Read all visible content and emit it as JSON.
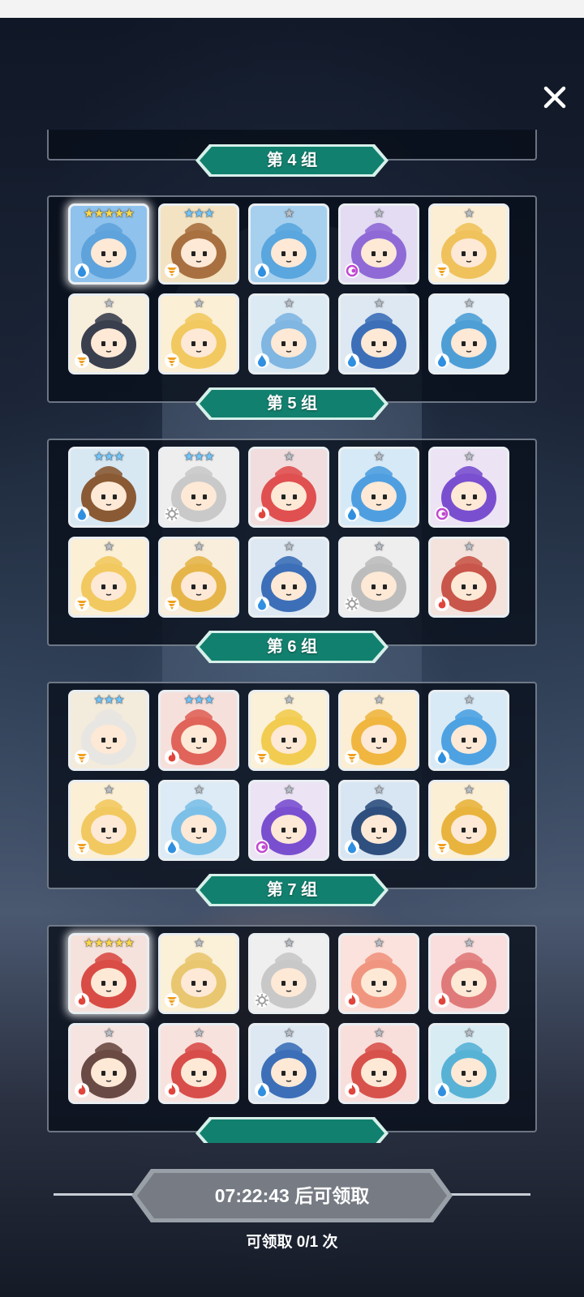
{
  "close_icon": "close-icon",
  "groups": [
    {
      "label": "第 4 组",
      "heroes": [
        {
          "stars": "★★★★★",
          "star_color": "#ffd84a",
          "element": "water",
          "bg": "#8fc2ec",
          "body": "#5fa3dc",
          "highlight": true
        },
        {
          "stars": "★★★",
          "star_color": "#6fc6ff",
          "element": "wind",
          "bg": "#f3e3c2",
          "body": "#a87040",
          "highlight": false
        },
        {
          "stars": "★",
          "star_color": "#b8bec6",
          "element": "water",
          "bg": "#a7d0ef",
          "body": "#5aa6de",
          "highlight": false
        },
        {
          "stars": "★",
          "star_color": "#b8bec6",
          "element": "dark",
          "bg": "#e3dcf2",
          "body": "#8f6ad6",
          "highlight": false
        },
        {
          "stars": "★",
          "star_color": "#b8bec6",
          "element": "wind",
          "bg": "#fbeed4",
          "body": "#f0c25c",
          "highlight": false
        },
        {
          "stars": "★",
          "star_color": "#b8bec6",
          "element": "wind",
          "bg": "#f7eedc",
          "body": "#3a3f4e",
          "highlight": false
        },
        {
          "stars": "★",
          "star_color": "#b8bec6",
          "element": "wind",
          "bg": "#fbefd6",
          "body": "#f2c960",
          "highlight": false
        },
        {
          "stars": "★",
          "star_color": "#b8bec6",
          "element": "water",
          "bg": "#dceaf4",
          "body": "#7fb6e2",
          "highlight": false
        },
        {
          "stars": "★",
          "star_color": "#b8bec6",
          "element": "water",
          "bg": "#dde8f2",
          "body": "#3c6fb8",
          "highlight": false
        },
        {
          "stars": "★",
          "star_color": "#b8bec6",
          "element": "water",
          "bg": "#e3eef6",
          "body": "#4e9ed6",
          "highlight": false
        }
      ]
    },
    {
      "label": "第 5 组",
      "heroes": [
        {
          "stars": "★★★",
          "star_color": "#6fc6ff",
          "element": "water",
          "bg": "#d7e8f3",
          "body": "#8a5a34",
          "highlight": false
        },
        {
          "stars": "★★★",
          "star_color": "#6fc6ff",
          "element": "light",
          "bg": "#eeeeee",
          "body": "#c9c9c9",
          "highlight": false
        },
        {
          "stars": "★",
          "star_color": "#b8bec6",
          "element": "fire",
          "bg": "#f1dddd",
          "body": "#e05050",
          "highlight": false
        },
        {
          "stars": "★",
          "star_color": "#b8bec6",
          "element": "water",
          "bg": "#d6e9f6",
          "body": "#4f9fe0",
          "highlight": false
        },
        {
          "stars": "★",
          "star_color": "#b8bec6",
          "element": "dark",
          "bg": "#ece3f5",
          "body": "#7a4fcf",
          "highlight": false
        },
        {
          "stars": "★",
          "star_color": "#b8bec6",
          "element": "wind",
          "bg": "#fbefd6",
          "body": "#f2c960",
          "highlight": false
        },
        {
          "stars": "★",
          "star_color": "#b8bec6",
          "element": "wind",
          "bg": "#f8eedb",
          "body": "#e6b54a",
          "highlight": false
        },
        {
          "stars": "★",
          "star_color": "#b8bec6",
          "element": "water",
          "bg": "#dde8f2",
          "body": "#3c6fb8",
          "highlight": false
        },
        {
          "stars": "★",
          "star_color": "#b8bec6",
          "element": "light",
          "bg": "#eeeeee",
          "body": "#bcbcbc",
          "highlight": false
        },
        {
          "stars": "★",
          "star_color": "#b8bec6",
          "element": "fire",
          "bg": "#f3e3dc",
          "body": "#c9564a",
          "highlight": false
        }
      ]
    },
    {
      "label": "第 6 组",
      "heroes": [
        {
          "stars": "★★★",
          "star_color": "#6fc6ff",
          "element": "wind",
          "bg": "#f3ebdc",
          "body": "#e8e6e2",
          "highlight": false
        },
        {
          "stars": "★★★",
          "star_color": "#6fc6ff",
          "element": "fire",
          "bg": "#f6e0dc",
          "body": "#e0645a",
          "highlight": false
        },
        {
          "stars": "★",
          "star_color": "#b8bec6",
          "element": "wind",
          "bg": "#fbf1d8",
          "body": "#f2cc50",
          "highlight": false
        },
        {
          "stars": "★",
          "star_color": "#b8bec6",
          "element": "wind",
          "bg": "#fbeed4",
          "body": "#f0b640",
          "highlight": false
        },
        {
          "stars": "★",
          "star_color": "#b8bec6",
          "element": "water",
          "bg": "#d8eaf6",
          "body": "#4ea2e2",
          "highlight": false
        },
        {
          "stars": "★",
          "star_color": "#b8bec6",
          "element": "wind",
          "bg": "#fbefd6",
          "body": "#f2c960",
          "highlight": false
        },
        {
          "stars": "★",
          "star_color": "#b8bec6",
          "element": "water",
          "bg": "#dcebf6",
          "body": "#7cc0e8",
          "highlight": false
        },
        {
          "stars": "★",
          "star_color": "#b8bec6",
          "element": "dark",
          "bg": "#ece3f5",
          "body": "#7a4fcf",
          "highlight": false
        },
        {
          "stars": "★",
          "star_color": "#b8bec6",
          "element": "water",
          "bg": "#d8e6f3",
          "body": "#2f4f7e",
          "highlight": false
        },
        {
          "stars": "★",
          "star_color": "#b8bec6",
          "element": "wind",
          "bg": "#fbefd6",
          "body": "#e9b43e",
          "highlight": false
        }
      ]
    },
    {
      "label": "第 7 组",
      "heroes": [
        {
          "stars": "★★★★★",
          "star_color": "#ffd84a",
          "element": "fire",
          "bg": "#f5e2dc",
          "body": "#d94c46",
          "highlight": true
        },
        {
          "stars": "★",
          "star_color": "#b8bec6",
          "element": "wind",
          "bg": "#fbf0d8",
          "body": "#e9c670",
          "highlight": false
        },
        {
          "stars": "★",
          "star_color": "#b8bec6",
          "element": "light",
          "bg": "#efefef",
          "body": "#c8c8c8",
          "highlight": false
        },
        {
          "stars": "★",
          "star_color": "#b8bec6",
          "element": "fire",
          "bg": "#fbe2dc",
          "body": "#f09680",
          "highlight": false
        },
        {
          "stars": "★",
          "star_color": "#b8bec6",
          "element": "fire",
          "bg": "#f9dedd",
          "body": "#e07a7a",
          "highlight": false
        },
        {
          "stars": "★",
          "star_color": "#b8bec6",
          "element": "fire",
          "bg": "#f6e4e0",
          "body": "#6a4a44",
          "highlight": false
        },
        {
          "stars": "★",
          "star_color": "#b8bec6",
          "element": "fire",
          "bg": "#f8e2de",
          "body": "#d84e4a",
          "highlight": false
        },
        {
          "stars": "★",
          "star_color": "#b8bec6",
          "element": "water",
          "bg": "#dde8f2",
          "body": "#3c6fb8",
          "highlight": false
        },
        {
          "stars": "★",
          "star_color": "#b8bec6",
          "element": "fire",
          "bg": "#f8dfdc",
          "body": "#d8524c",
          "highlight": false
        },
        {
          "stars": "★",
          "star_color": "#b8bec6",
          "element": "water",
          "bg": "#d8ecf4",
          "body": "#58b2d6",
          "highlight": false
        }
      ]
    }
  ],
  "footer": {
    "timer": "07:22:43 后可领取",
    "claim_count": "可领取 0/1 次"
  },
  "colors": {
    "header_teal": "#12806e",
    "header_border": "#d6f0ea",
    "plate_gray": "#777c84"
  }
}
